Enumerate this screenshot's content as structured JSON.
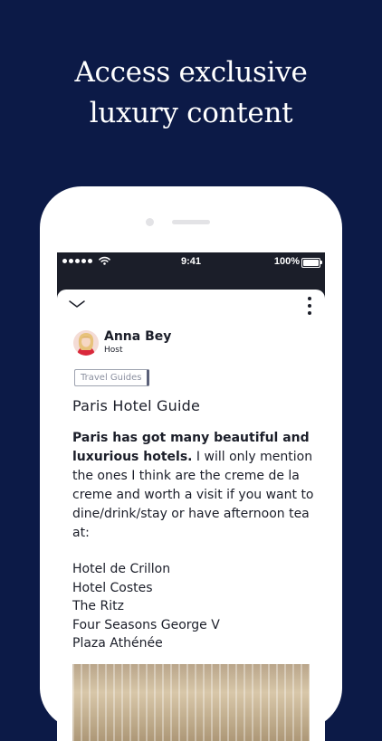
{
  "headline": {
    "line1": "Access exclusive",
    "line2": "luxury content"
  },
  "status_bar": {
    "time": "9:41",
    "battery": "100%",
    "signal_icon": "signal-dots-icon",
    "wifi_icon": "wifi-icon",
    "battery_icon": "battery-icon"
  },
  "sheet": {
    "collapse_icon": "chevron-down-icon",
    "menu_icon": "more-vertical-icon"
  },
  "author": {
    "name": "Anna Bey",
    "role": "Host"
  },
  "tag": "Travel Guides",
  "article": {
    "title": "Paris Hotel Guide",
    "lead_bold": "Paris has got many beautiful and luxurious hotels.",
    "lead_rest": " I will only mention the ones I think are the creme de la creme and worth a visit if you want to dine/drink/stay or have afternoon tea at:",
    "hotels": [
      "Hotel de Crillon",
      "Hotel Costes",
      "The Ritz",
      "Four Seasons George V",
      "Plaza Athénée"
    ]
  },
  "colors": {
    "background": "#0c1a47",
    "text": "#1b1e29",
    "tag_border": "#9ea3b0"
  }
}
